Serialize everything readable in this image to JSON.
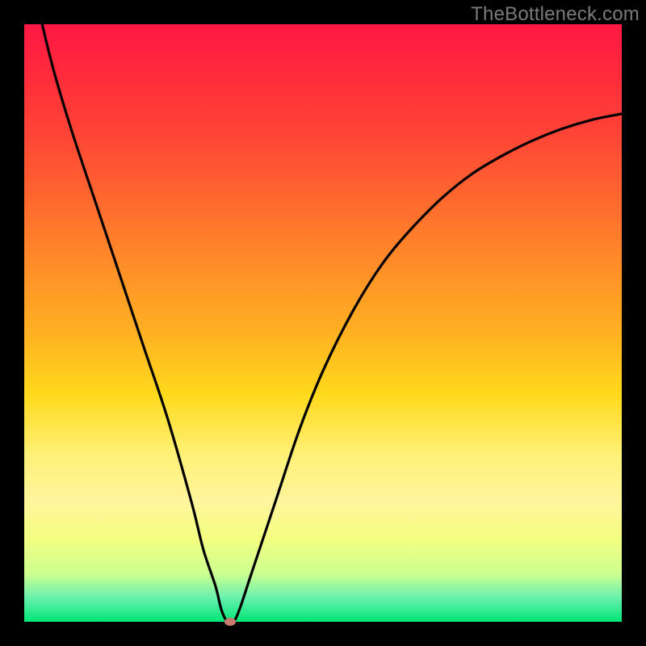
{
  "watermark": {
    "text": "TheBottleneck.com"
  },
  "chart_data": {
    "type": "line",
    "title": "",
    "xlabel": "",
    "ylabel": "",
    "xlim": [
      0,
      100
    ],
    "ylim": [
      0,
      100
    ],
    "series": [
      {
        "name": "bottleneck-curve",
        "x": [
          3,
          5,
          8,
          12,
          16,
          20,
          24,
          28,
          30,
          32,
          33,
          34,
          35,
          36,
          38,
          42,
          46,
          50,
          55,
          60,
          65,
          70,
          75,
          80,
          85,
          90,
          95,
          100
        ],
        "values": [
          100,
          92,
          82,
          70,
          58,
          46,
          34,
          20,
          12,
          6,
          2,
          0,
          0,
          2,
          8,
          20,
          32,
          42,
          52,
          60,
          66,
          71,
          75,
          78,
          80.5,
          82.5,
          84,
          85
        ]
      }
    ],
    "marker": {
      "x": 34.5,
      "y": 0,
      "color": "#c97a6e"
    },
    "gradient_stops": [
      {
        "pos": 0,
        "color": "#ff1744"
      },
      {
        "pos": 50,
        "color": "#ffd600"
      },
      {
        "pos": 100,
        "color": "#00e676"
      }
    ]
  }
}
